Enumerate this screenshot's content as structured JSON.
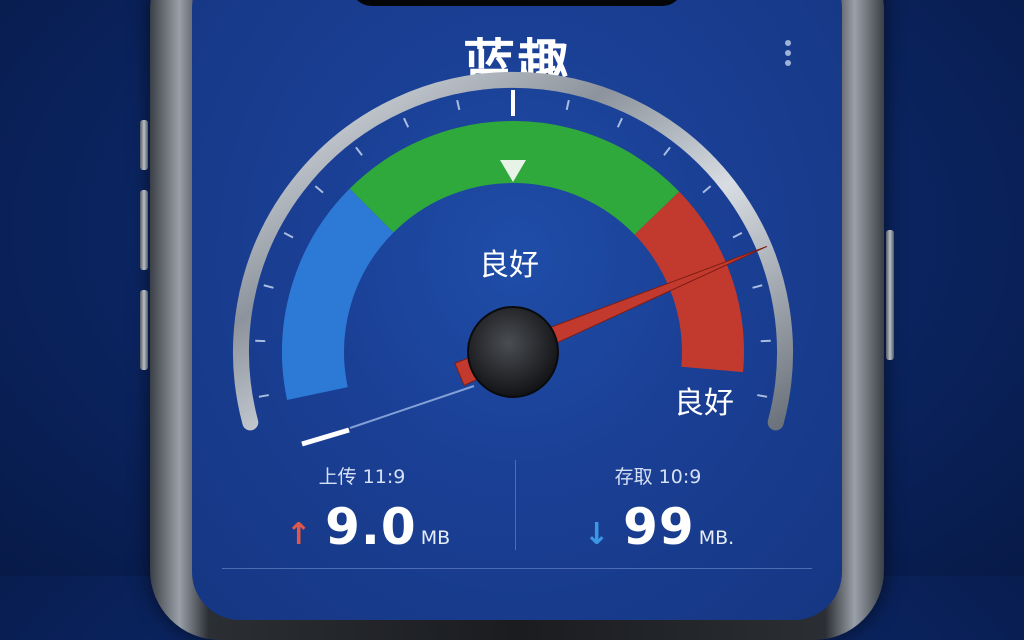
{
  "app": {
    "title": "蓝趣"
  },
  "gauge": {
    "center_label": "良好",
    "side_label": "良好",
    "needle_value": 0.86,
    "colors": {
      "low": "#2c7ad6",
      "mid": "#2fa83c",
      "high": "#c23a2e"
    }
  },
  "upload": {
    "label": "上传 11:9",
    "value": "9.0",
    "unit": "MB",
    "arrow_color": "#e0584a"
  },
  "download": {
    "label": "存取 10:9",
    "value": "99",
    "unit": "MB.",
    "arrow_color": "#3c96e6"
  }
}
